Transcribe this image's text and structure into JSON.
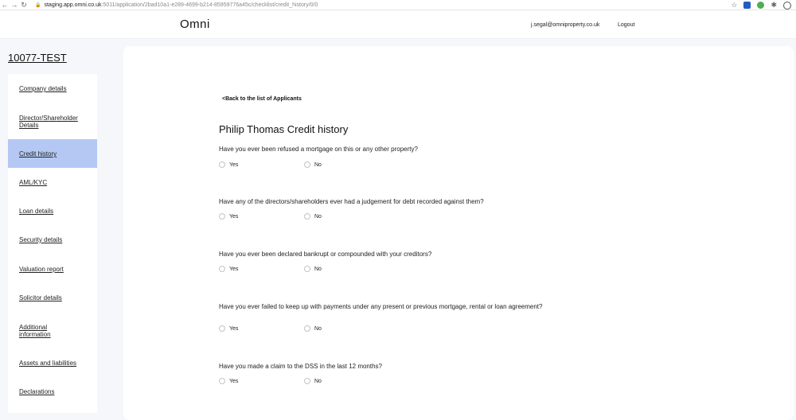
{
  "browser": {
    "url_host": "staging.app.omni.co.uk",
    "url_path": ":5011/application/2bad10a1-e289-4699-b214-85959776a45c/checklist/credit_history/0/0"
  },
  "header": {
    "brand": "Omni",
    "user_email": "j.segal@omniproperty.co.uk",
    "logout_label": "Logout"
  },
  "application": {
    "id": "10077-TEST"
  },
  "sidebar": {
    "items": [
      {
        "label": "Company details"
      },
      {
        "label": "Director/Shareholder Details"
      },
      {
        "label": "Credit history"
      },
      {
        "label": "AML/KYC"
      },
      {
        "label": "Loan details"
      },
      {
        "label": "Security details"
      },
      {
        "label": "Valuation report"
      },
      {
        "label": "Solicitor details"
      },
      {
        "label": "Additional information"
      },
      {
        "label": "Assets and liabilities"
      },
      {
        "label": "Declarations"
      }
    ],
    "active": "Credit history"
  },
  "main": {
    "back_link": "<Back to the list of Applicants",
    "title": "Philip Thomas Credit history",
    "option_yes": "Yes",
    "option_no": "No",
    "questions": [
      {
        "text": "Have you ever been refused a mortgage on this or any other property?"
      },
      {
        "text": "Have any of the directors/shareholders ever had a judgement for debt recorded against them?"
      },
      {
        "text": "Have you ever been declared bankrupt or compounded with your creditors?"
      },
      {
        "text": "Have you ever failed to keep up with payments under any present or previous mortgage, rental or loan agreement?"
      },
      {
        "text": "Have you made a claim to the DSS in the last 12 months?"
      }
    ]
  },
  "colors": {
    "active_nav": "#b4c8f3",
    "page_bg": "#f5f7fb"
  }
}
